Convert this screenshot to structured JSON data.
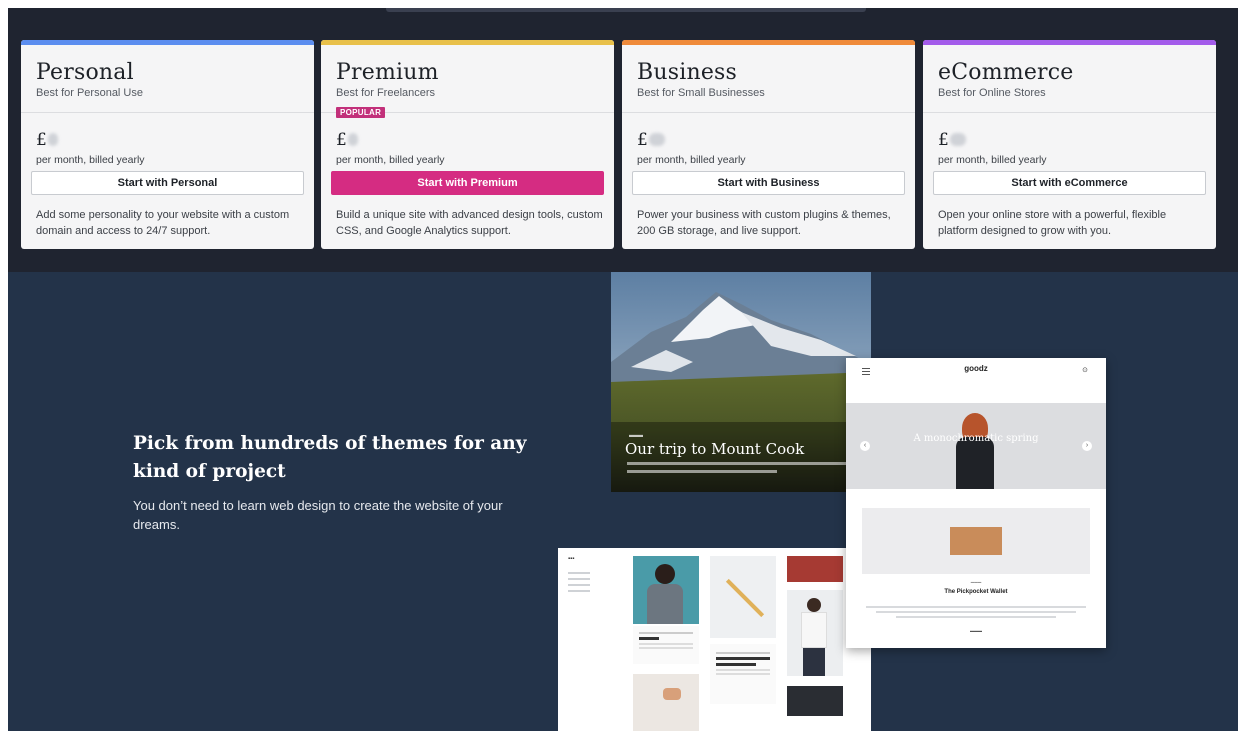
{
  "pricing": {
    "plans": [
      {
        "name": "Personal",
        "tagline": "Best for Personal Use",
        "currency": "£",
        "billing": "per month, billed yearly",
        "cta": "Start with Personal",
        "description": "Add some personality to your website with a custom domain and access to 24/7 support.",
        "accent": "#5b8def",
        "popular": false
      },
      {
        "name": "Premium",
        "tagline": "Best for Freelancers",
        "badge": "POPULAR",
        "currency": "£",
        "billing": "per month, billed yearly",
        "cta": "Start with Premium",
        "description": "Build a unique site with advanced design tools, custom CSS, and Google Analytics support.",
        "accent": "#e8c04a",
        "popular": true
      },
      {
        "name": "Business",
        "tagline": "Best for Small Businesses",
        "currency": "£",
        "billing": "per month, billed yearly",
        "cta": "Start with Business",
        "description": "Power your business with custom plugins & themes, 200 GB storage, and live support.",
        "accent": "#ef8a3a",
        "popular": false
      },
      {
        "name": "eCommerce",
        "tagline": "Best for Online Stores",
        "currency": "£",
        "billing": "per month, billed yearly",
        "cta": "Start with eCommerce",
        "description": "Open your online store with a powerful, flexible platform designed to grow with you.",
        "accent": "#a35bea",
        "popular": false
      }
    ]
  },
  "themes": {
    "heading": "Pick from hundreds of themes for any kind of project",
    "subtext": "You don’t need to learn web design to create the website of your dreams.",
    "mountain_preview": {
      "title": "Our trip to Mount Cook"
    },
    "goods_preview": {
      "logo": "goodz",
      "hero_text": "A monochromatic spring",
      "product": "The Pickpocket Wallet"
    }
  },
  "colors": {
    "pricing_bg": "#1f2430",
    "themes_bg": "#233349",
    "primary_cta": "#d52c82"
  }
}
